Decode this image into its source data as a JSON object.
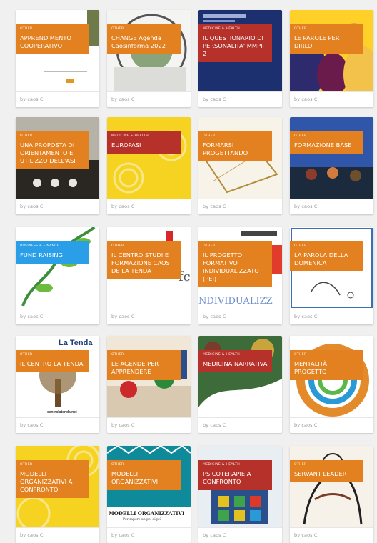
{
  "cards": [
    {
      "category": "OTHER",
      "title": "APPRENDIMENTO COOPERATIVO",
      "author": "by caos C",
      "color": "#e3801f"
    },
    {
      "category": "OTHER",
      "title": "CHANGE Agenda Caosinforma 2022",
      "author": "by caos C",
      "color": "#e3801f"
    },
    {
      "category": "MEDICINE & HEALTH",
      "title": "IL QUESTIONARIO DI PERSONALITA' MMPI-2",
      "author": "by caos C",
      "color": "#b5312a"
    },
    {
      "category": "OTHER",
      "title": "LE PAROLE PER DIRLO",
      "author": "by caos C",
      "color": "#e3801f"
    },
    {
      "category": "OTHER",
      "title": "UNA PROPOSTA DI ORIENTAMENTO E UTILIZZO DELL'ASI",
      "author": "by caos C",
      "color": "#e3801f"
    },
    {
      "category": "MEDICINE & HEALTH",
      "title": "EUROPASI",
      "author": "by caos C",
      "color": "#b5312a"
    },
    {
      "category": "OTHER",
      "title": "FORMARSI PROGETTANDO",
      "author": "by caos C",
      "color": "#e3801f"
    },
    {
      "category": "OTHER",
      "title": "FORMAZIONE BASE",
      "author": "by caos C",
      "color": "#e3801f"
    },
    {
      "category": "BUSINESS & FINANCE",
      "title": "FUND RAISING",
      "author": "by caos C",
      "color": "#2b9ee8"
    },
    {
      "category": "OTHER",
      "title": "IL CENTRO STUDI E FORMAZIONE CAOS DE LA TENDA",
      "author": "by caos C",
      "color": "#e3801f"
    },
    {
      "category": "OTHER",
      "title": "IL PROGETTO FORMATIVO INDIVIDUALIZZATO (PEI)",
      "author": "by caos C",
      "color": "#e3801f"
    },
    {
      "category": "OTHER",
      "title": "LA PAROLA DELLA DOMENICA",
      "author": "by caos C",
      "color": "#e3801f"
    },
    {
      "category": "OTHER",
      "title": "IL CENTRO LA TENDA",
      "author": "by caos C",
      "color": "#e3801f"
    },
    {
      "category": "OTHER",
      "title": "LE AGENDE PER APPRENDERE",
      "author": "by caos C",
      "color": "#e3801f"
    },
    {
      "category": "MEDICINE & HEALTH",
      "title": "MEDICINA NARRATIVA",
      "author": "by caos C",
      "color": "#b5312a"
    },
    {
      "category": "OTHER",
      "title": "MENTALITÀ PROGETTO",
      "author": "by caos C",
      "color": "#e3801f"
    },
    {
      "category": "OTHER",
      "title": "MODELLI ORGANIZZATIVI A CONFRONTO",
      "author": "by caos C",
      "color": "#e3801f"
    },
    {
      "category": "OTHER",
      "title": "MODELLI ORGANIZZATIVI",
      "author": "by caos C",
      "color": "#e3801f"
    },
    {
      "category": "MEDICINE & HEALTH",
      "title": "PSICOTERAPIE A CONFRONTO",
      "author": "by caos C",
      "color": "#b5312a"
    },
    {
      "category": "OTHER",
      "title": "SERVANT LEADER",
      "author": "by caos C",
      "color": "#e3801f"
    }
  ],
  "thumb_texts": {
    "latenda_logo": "La Tenda",
    "centrolatenda": "centrolatenda.net",
    "modelli_banner": "MODELLI ORGANIZZATIVI",
    "modelli_sub": "Per sapere un po' di più",
    "individualizz": "NDIVIDUALIZZ"
  }
}
